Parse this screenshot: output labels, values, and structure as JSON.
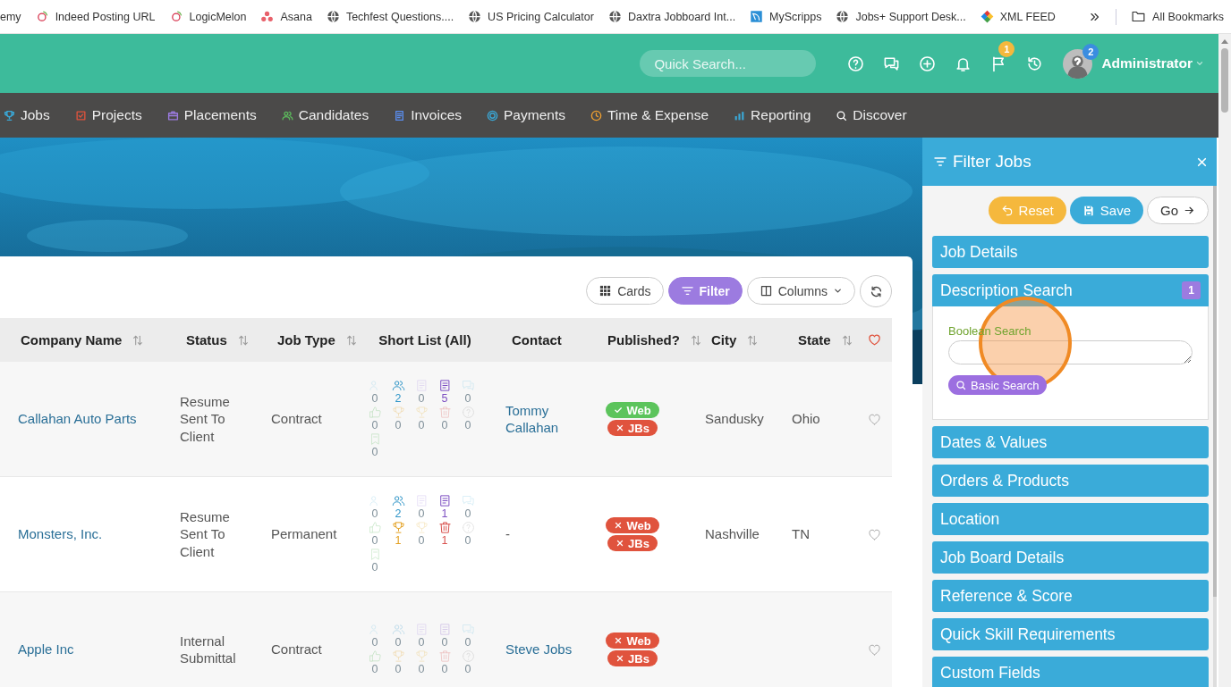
{
  "bookmarks": {
    "items": [
      "emy",
      "Indeed Posting URL",
      "LogicMelon",
      "Asana",
      "Techfest Questions....",
      "US Pricing Calculator",
      "Daxtra Jobboard Int...",
      "MyScripps",
      "Jobs+ Support Desk...",
      "XML FEED"
    ],
    "all": "All Bookmarks"
  },
  "header": {
    "search_placeholder": "Quick Search...",
    "flag_badge": "1",
    "avatar_badge": "2",
    "user": "Administrator"
  },
  "nav": [
    {
      "label": "Jobs"
    },
    {
      "label": "Projects"
    },
    {
      "label": "Placements"
    },
    {
      "label": "Candidates"
    },
    {
      "label": "Invoices"
    },
    {
      "label": "Payments"
    },
    {
      "label": "Time & Expense"
    },
    {
      "label": "Reporting"
    },
    {
      "label": "Discover"
    }
  ],
  "toolbar": [
    {
      "label": "Cards",
      "selected": false
    },
    {
      "label": "Filter",
      "selected": true
    },
    {
      "label": "Columns",
      "selected": false
    }
  ],
  "table": {
    "columns": [
      {
        "label": "Company Name",
        "sortable": true
      },
      {
        "label": "Status",
        "sortable": true
      },
      {
        "label": "Job Type",
        "sortable": true
      },
      {
        "label": "Short List (All)",
        "sortable": false
      },
      {
        "label": "Contact",
        "sortable": false
      },
      {
        "label": "Published?",
        "sortable": true
      },
      {
        "label": "City",
        "sortable": true
      },
      {
        "label": "State",
        "sortable": true
      }
    ],
    "favorites_header_active": true,
    "rows": [
      {
        "company": "Callahan Auto Parts",
        "status": "Resume Sent To Client",
        "job_type": "Contract",
        "shortlist": [
          {
            "count": "0",
            "active": false
          },
          {
            "count": "2",
            "active": true
          },
          {
            "count": "0",
            "active": false
          },
          {
            "count": "5",
            "active": true
          },
          {
            "count": "0",
            "active": false
          },
          {
            "count": "0",
            "active": false
          },
          {
            "count": "0",
            "active": false
          },
          {
            "count": "0",
            "active": false
          },
          {
            "count": "0",
            "active": false
          },
          {
            "count": "0",
            "active": false
          },
          {
            "count": "0",
            "active": false
          }
        ],
        "contact": "Tommy Callahan",
        "contact_is_link": true,
        "published": [
          {
            "label": "Web",
            "on": true
          },
          {
            "label": "JBs",
            "on": false
          }
        ],
        "city": "Sandusky",
        "state": "Ohio",
        "favorite": false
      },
      {
        "company": "Monsters, Inc.",
        "status": "Resume Sent To Client",
        "job_type": "Permanent",
        "shortlist": [
          {
            "count": "0",
            "active": false
          },
          {
            "count": "2",
            "active": true
          },
          {
            "count": "0",
            "active": false
          },
          {
            "count": "1",
            "active": true
          },
          {
            "count": "0",
            "active": false
          },
          {
            "count": "0",
            "active": false
          },
          {
            "count": "1",
            "active": true
          },
          {
            "count": "0",
            "active": false
          },
          {
            "count": "1",
            "active": true
          },
          {
            "count": "0",
            "active": false
          },
          {
            "count": "0",
            "active": false
          }
        ],
        "contact": "-",
        "contact_is_link": false,
        "published": [
          {
            "label": "Web",
            "on": false
          },
          {
            "label": "JBs",
            "on": false
          }
        ],
        "city": "Nashville",
        "state": "TN",
        "favorite": false
      },
      {
        "company": "Apple Inc",
        "status": "Internal Submittal",
        "job_type": "Contract",
        "shortlist": [
          {
            "count": "0",
            "active": false
          },
          {
            "count": "0",
            "active": false
          },
          {
            "count": "0",
            "active": false
          },
          {
            "count": "0",
            "active": false
          },
          {
            "count": "0",
            "active": false
          },
          {
            "count": "0",
            "active": false
          },
          {
            "count": "0",
            "active": false
          },
          {
            "count": "0",
            "active": false
          },
          {
            "count": "0",
            "active": false
          },
          {
            "count": "0",
            "active": false
          }
        ],
        "contact": "Steve Jobs",
        "contact_is_link": true,
        "published": [
          {
            "label": "Web",
            "on": false
          },
          {
            "label": "JBs",
            "on": false
          }
        ],
        "favorite": false
      }
    ]
  },
  "filter_panel": {
    "title": "Filter Jobs",
    "buttons": [
      {
        "label": "Reset"
      },
      {
        "label": "Save"
      },
      {
        "label": "Go"
      }
    ],
    "sections": [
      {
        "title": "Job Details",
        "expanded": false
      },
      {
        "title": "Description Search",
        "expanded": true,
        "badge": "1",
        "field_label": "Boolean Search",
        "action": "Basic Search"
      },
      {
        "title": "Dates & Values",
        "expanded": false
      },
      {
        "title": "Orders & Products",
        "expanded": false
      },
      {
        "title": "Location",
        "expanded": false
      },
      {
        "title": "Job Board Details",
        "expanded": false
      },
      {
        "title": "Reference & Score",
        "expanded": false
      },
      {
        "title": "Quick Skill Requirements",
        "expanded": false
      },
      {
        "title": "Custom Fields",
        "expanded": false
      }
    ]
  },
  "click_highlight": true
}
